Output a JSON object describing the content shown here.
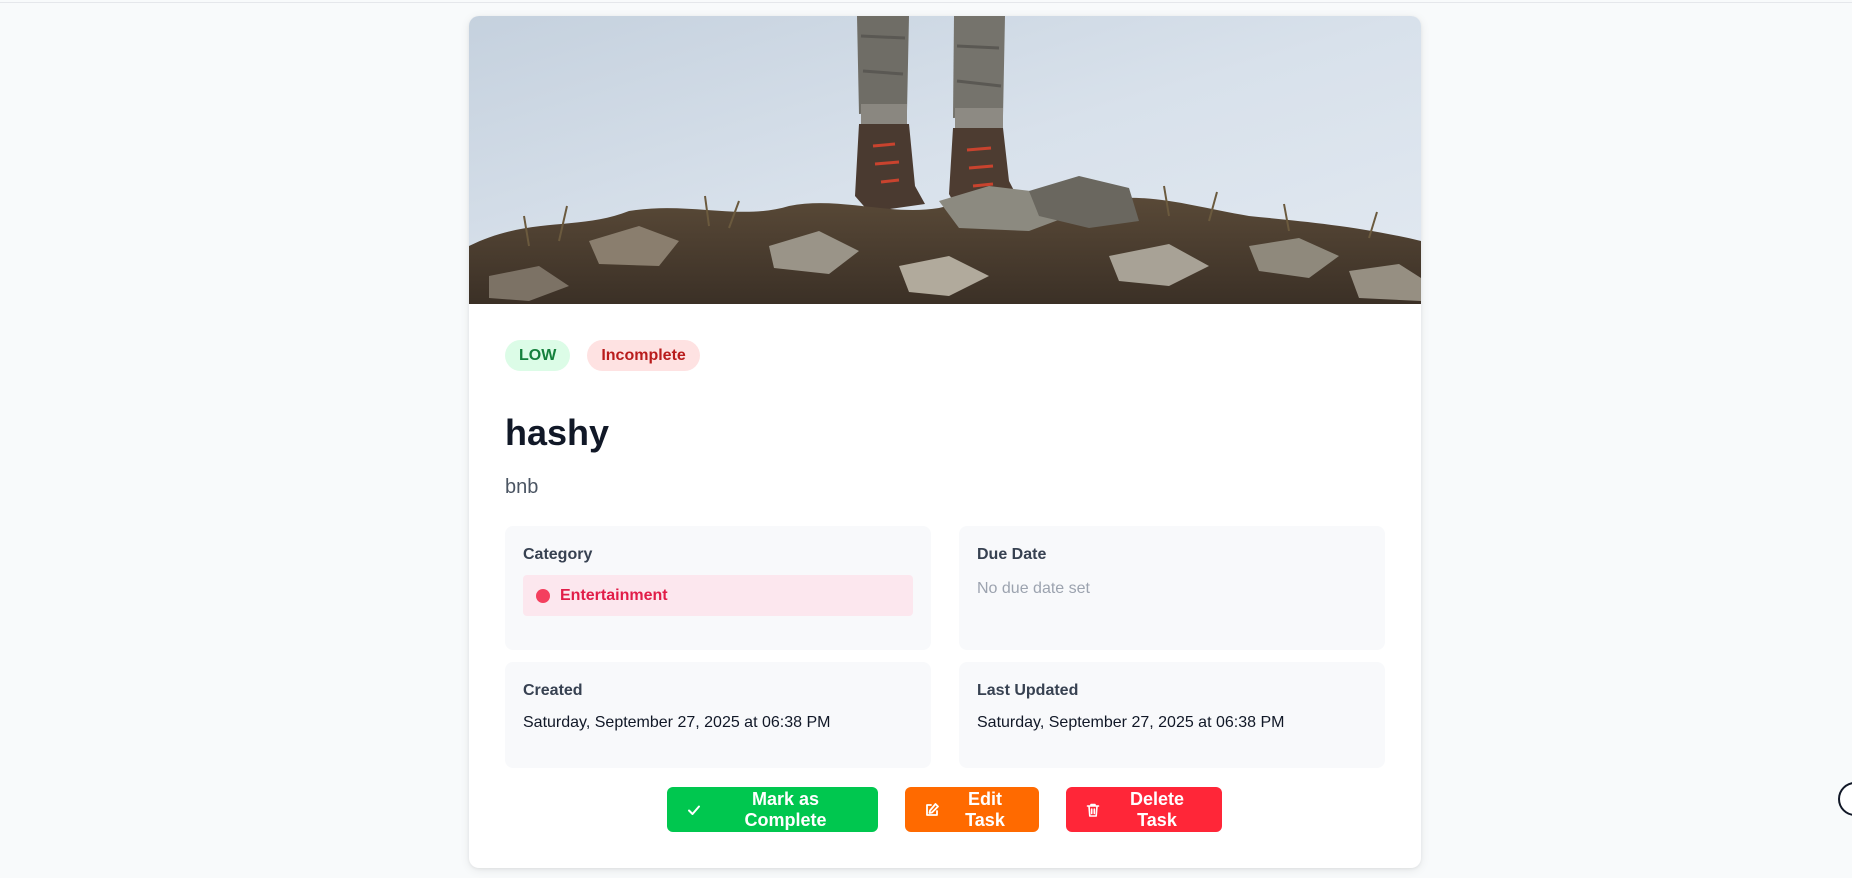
{
  "task": {
    "image_alt": "hiker boots on rocky summit",
    "priority": "LOW",
    "status": "Incomplete",
    "title": "hashy",
    "description": "bnb"
  },
  "details": {
    "category_label": "Category",
    "category_value": "Entertainment",
    "due_label": "Due Date",
    "due_value": "No due date set",
    "created_label": "Created",
    "created_value": "Saturday, September 27, 2025 at 06:38 PM",
    "updated_label": "Last Updated",
    "updated_value": "Saturday, September 27, 2025 at 06:38 PM"
  },
  "actions": {
    "complete": "Mark as Complete",
    "edit": "Edit Task",
    "delete": "Delete Task"
  },
  "colors": {
    "priority_low_bg": "#dcfce7",
    "status_incomplete_bg": "#fee2e2",
    "category_color": "#f43f5e",
    "complete_button": "#00c74f",
    "edit_button": "#ff6a00",
    "delete_button": "#ff2638"
  },
  "icons": {
    "complete": "check-icon",
    "edit": "edit-icon",
    "delete": "trash-icon",
    "category": "category-dot-icon"
  }
}
